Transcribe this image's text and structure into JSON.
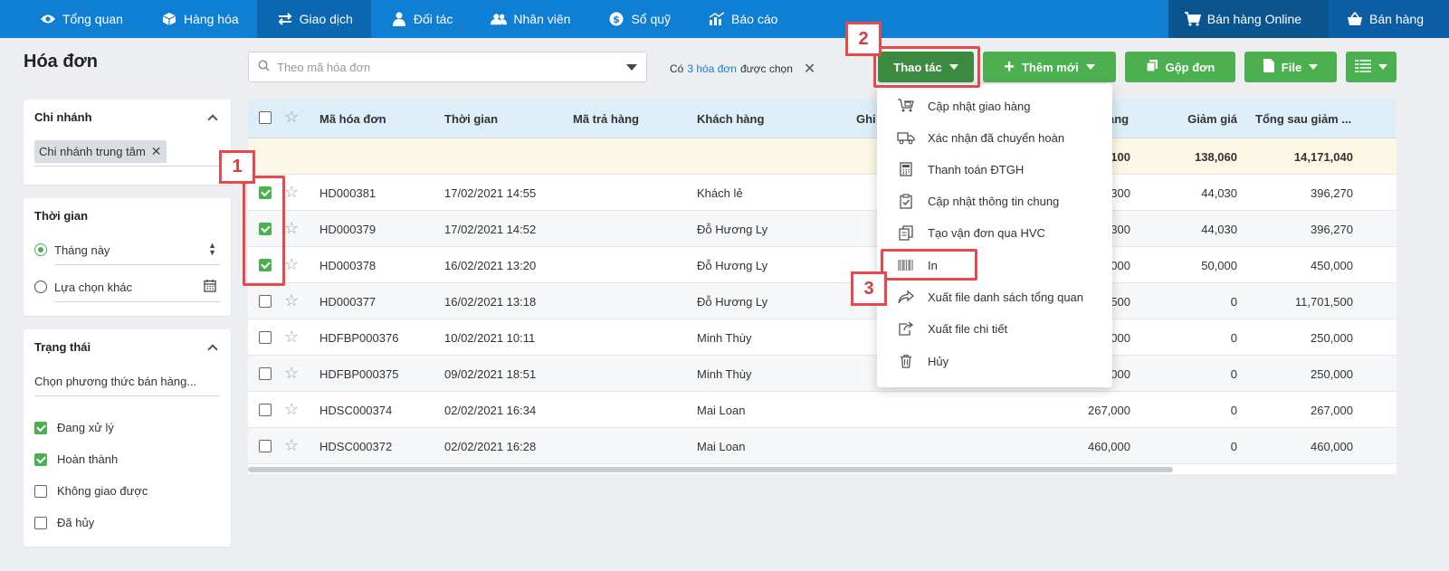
{
  "nav": {
    "items": [
      {
        "label": "Tổng quan",
        "icon": "eye-icon"
      },
      {
        "label": "Hàng hóa",
        "icon": "box-icon"
      },
      {
        "label": "Giao dịch",
        "icon": "transfer-icon"
      },
      {
        "label": "Đối tác",
        "icon": "partner-icon"
      },
      {
        "label": "Nhân viên",
        "icon": "users-icon"
      },
      {
        "label": "Sổ quỹ",
        "icon": "dollar-icon"
      },
      {
        "label": "Báo cáo",
        "icon": "chart-icon"
      }
    ],
    "right": [
      {
        "label": "Bán hàng Online",
        "icon": "cart-icon"
      },
      {
        "label": "Bán hàng",
        "icon": "basket-icon"
      }
    ]
  },
  "page": {
    "title": "Hóa đơn"
  },
  "filters": {
    "branch": {
      "title": "Chi nhánh",
      "tag": "Chi nhánh trung tâm"
    },
    "time": {
      "title": "Thời gian",
      "option1": "Tháng này",
      "option2": "Lựa chọn khác"
    },
    "status": {
      "title": "Trạng thái",
      "placeholder": "Chọn phương thức bán hàng...",
      "options": [
        {
          "label": "Đang xử lý",
          "checked": true
        },
        {
          "label": "Hoàn thành",
          "checked": true
        },
        {
          "label": "Không giao được",
          "checked": false
        },
        {
          "label": "Đã hủy",
          "checked": false
        }
      ]
    }
  },
  "search": {
    "placeholder": "Theo mã hóa đơn"
  },
  "selection": {
    "prefix": "Có",
    "link": "3 hóa đơn",
    "suffix": "được chọn"
  },
  "toolbar": {
    "actions": "Thao tác",
    "add": "Thêm mới",
    "merge": "Gộp đơn",
    "file": "File"
  },
  "table": {
    "headers": {
      "code": "Mã hóa đơn",
      "time": "Thời gian",
      "return_code": "Mã trả hàng",
      "customer": "Khách hàng",
      "note": "Ghi",
      "total": "àng",
      "discount": "Giảm giá",
      "after": "Tổng sau giảm ..."
    },
    "summary": {
      "total": "100",
      "discount": "138,060",
      "after": "14,171,040"
    },
    "rows": [
      {
        "code": "HD000381",
        "time": "17/02/2021 14:55",
        "customer": "Khách lẻ",
        "total": "300",
        "discount": "44,030",
        "after": "396,270",
        "checked": true
      },
      {
        "code": "HD000379",
        "time": "17/02/2021 14:52",
        "customer": "Đỗ Hương Ly",
        "total": "300",
        "discount": "44,030",
        "after": "396,270",
        "checked": true
      },
      {
        "code": "HD000378",
        "time": "16/02/2021 13:20",
        "customer": "Đỗ Hương Ly",
        "total": "000",
        "discount": "50,000",
        "after": "450,000",
        "checked": true
      },
      {
        "code": "HD000377",
        "time": "16/02/2021 13:18",
        "customer": "Đỗ Hương Ly",
        "total": "500",
        "discount": "0",
        "after": "11,701,500",
        "checked": false
      },
      {
        "code": "HDFBP000376",
        "time": "10/02/2021 10:11",
        "customer": "Minh Thùy",
        "total": "000",
        "discount": "0",
        "after": "250,000",
        "checked": false
      },
      {
        "code": "HDFBP000375",
        "time": "09/02/2021 18:51",
        "customer": "Minh Thùy",
        "total": "000",
        "discount": "0",
        "after": "250,000",
        "checked": false
      },
      {
        "code": "HDSC000374",
        "time": "02/02/2021 16:34",
        "customer": "Mai Loan",
        "total": "267,000",
        "discount": "0",
        "after": "267,000",
        "checked": false
      },
      {
        "code": "HDSC000372",
        "time": "02/02/2021 16:28",
        "customer": "Mai Loan",
        "total": "460,000",
        "discount": "0",
        "after": "460,000",
        "checked": false
      }
    ]
  },
  "dropdown": {
    "items": [
      {
        "label": "Cập nhật giao hàng",
        "icon": "delivery-icon"
      },
      {
        "label": "Xác nhận đã chuyển hoàn",
        "icon": "return-truck-icon"
      },
      {
        "label": "Thanh toán ĐTGH",
        "icon": "calculator-icon"
      },
      {
        "label": "Cập nhật thông tin chung",
        "icon": "clipboard-check-icon"
      },
      {
        "label": "Tạo vận đơn qua HVC",
        "icon": "copy-doc-icon"
      },
      {
        "label": "In",
        "icon": "barcode-icon"
      },
      {
        "label": "Xuất file danh sách tổng quan",
        "icon": "share-icon"
      },
      {
        "label": "Xuất file chi tiết",
        "icon": "export-icon"
      },
      {
        "label": "Hủy",
        "icon": "trash-icon"
      }
    ]
  },
  "annotations": [
    "1",
    "2",
    "3"
  ],
  "colors": {
    "nav": "#0f7fd3",
    "green": "#4caf50",
    "annotation": "#e8474c"
  }
}
